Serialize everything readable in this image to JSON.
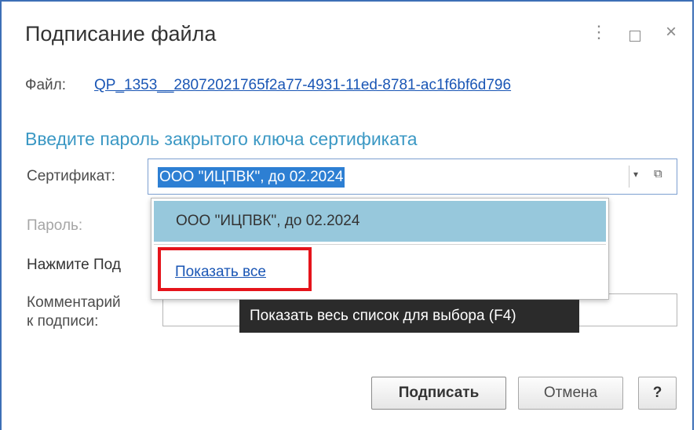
{
  "window": {
    "title": "Подписание файла",
    "more_icon": "⋮",
    "maximize_icon": "",
    "close_icon": "×"
  },
  "file": {
    "label": "Файл:",
    "link": "QP_1353__28072021765f2a77-4931-11ed-8781-ac1f6bf6d796"
  },
  "heading": "Введите пароль закрытого ключа сертификата",
  "certificate": {
    "label": "Сертификат:",
    "value": "ООО \"ИЦПВК\", до 02.2024",
    "dropdown_icon": "▾",
    "open_icon": "⧉"
  },
  "password": {
    "label": "Пароль:"
  },
  "press_text": "Нажмите Под",
  "comment": {
    "label_line1": "Комментарий",
    "label_line2": "к подписи:"
  },
  "dropdown": {
    "items": [
      {
        "label": "ООО \"ИЦПВК\", до 02.2024"
      }
    ],
    "show_all": "Показать все"
  },
  "tooltip": "Показать весь список для выбора (F4)",
  "buttons": {
    "sign": "Подписать",
    "cancel": "Отмена",
    "help": "?"
  },
  "colors": {
    "accent_heading": "#3b98c4",
    "link": "#1a56b5",
    "selection": "#2d7fd3",
    "dropdown_highlight": "#97c8dc",
    "annotation_box": "#e5141b"
  }
}
